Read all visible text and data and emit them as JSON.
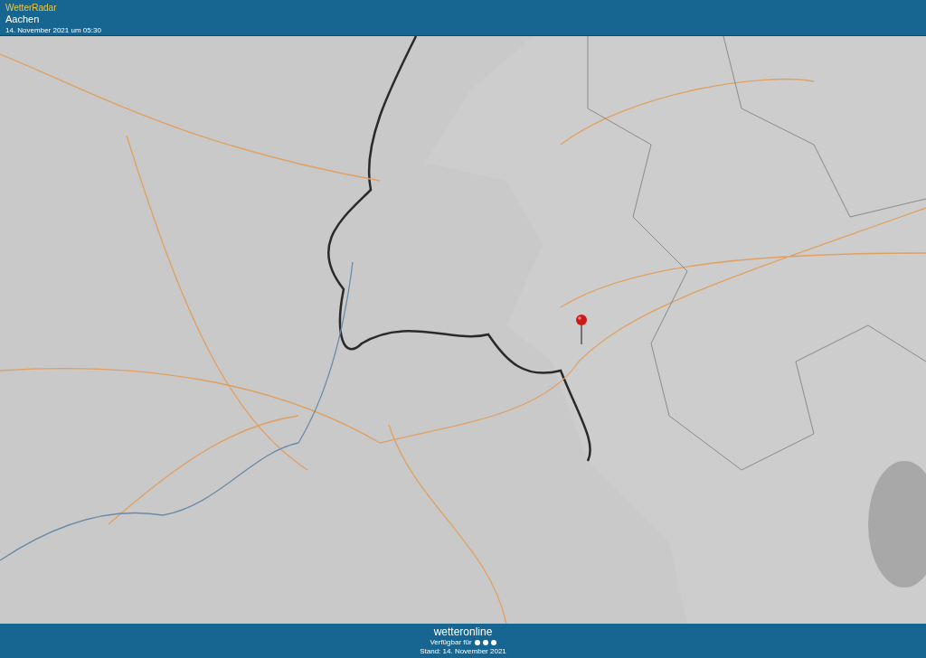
{
  "header": {
    "app_title": "WetterRadar",
    "location": "Aachen",
    "timestamp": "14. November 2021 um 05:30"
  },
  "footer": {
    "logo": "wetteronline",
    "available_label": "Verfügbar für",
    "stand": "Stand: 14. November 2021"
  }
}
